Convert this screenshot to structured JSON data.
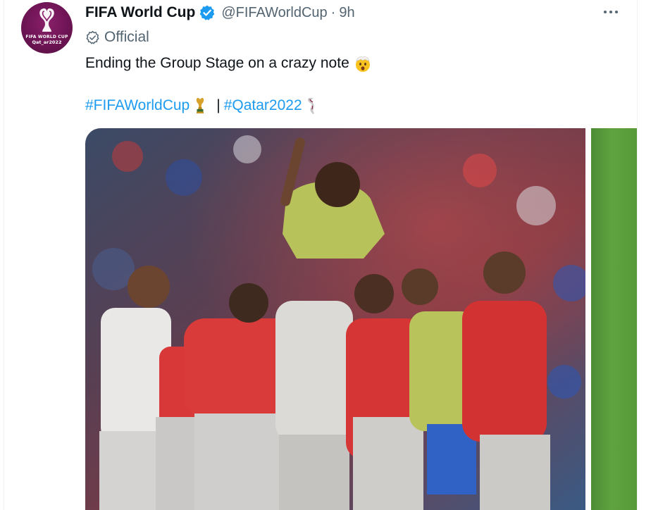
{
  "tweet": {
    "author_name": "FIFA World Cup",
    "handle": "@FIFAWorldCup",
    "separator": "·",
    "time": "9h",
    "official_label": "Official",
    "text": "Ending the Group Stage on a crazy note",
    "hashtags": [
      "#FIFAWorldCup",
      "#Qatar2022"
    ],
    "hashtag_separator": "|",
    "avatar_logo": {
      "line1": "FIFA WORLD CUP",
      "line2": "Qat_ar2022"
    }
  },
  "icons": {
    "verified": "verified-badge-icon",
    "more": "more-options-icon",
    "official": "official-check-icon",
    "mind_blown": "mind-blown-emoji-icon",
    "trophy": "trophy-emoji-icon",
    "mascot": "mascot-emoji-icon"
  },
  "colors": {
    "link": "#1d9bf0",
    "secondary_text": "#536471",
    "primary_text": "#0f1419",
    "avatar_bg": "#6d1454",
    "verified": "#1d9bf0"
  }
}
